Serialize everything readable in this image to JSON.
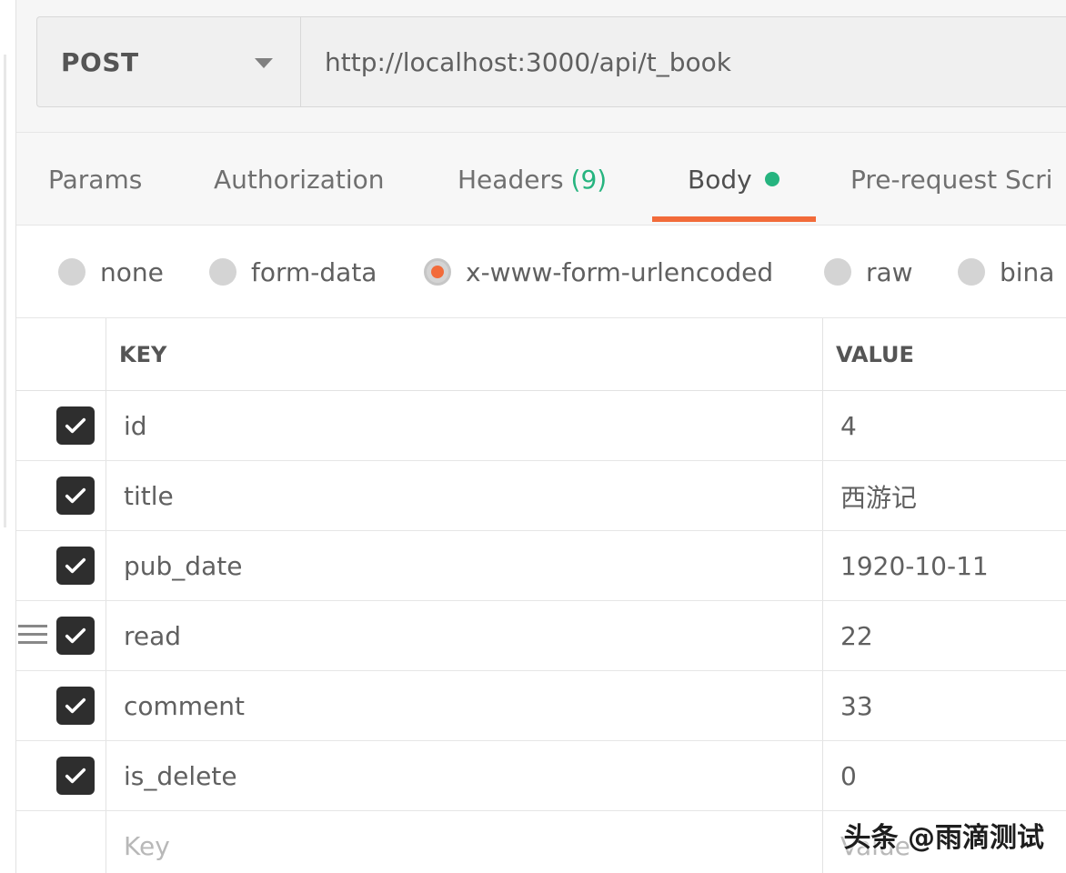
{
  "request": {
    "method": "POST",
    "url": "http://localhost:3000/api/t_book"
  },
  "tabs": [
    {
      "label": "Params"
    },
    {
      "label": "Authorization"
    },
    {
      "label": "Headers",
      "count": "(9)"
    },
    {
      "label": "Body"
    },
    {
      "label": "Pre-request Scri"
    }
  ],
  "body_types": [
    {
      "label": "none",
      "selected": false
    },
    {
      "label": "form-data",
      "selected": false
    },
    {
      "label": "x-www-form-urlencoded",
      "selected": true
    },
    {
      "label": "raw",
      "selected": false
    },
    {
      "label": "bina",
      "selected": false
    }
  ],
  "table": {
    "key_header": "KEY",
    "value_header": "VALUE",
    "rows": [
      {
        "key": "id",
        "value": "4",
        "checked": true
      },
      {
        "key": "title",
        "value": "西游记",
        "checked": true
      },
      {
        "key": "pub_date",
        "value": "1920-10-11",
        "checked": true
      },
      {
        "key": "read",
        "value": "22",
        "checked": true
      },
      {
        "key": "comment",
        "value": "33",
        "checked": true
      },
      {
        "key": "is_delete",
        "value": "0",
        "checked": true
      }
    ],
    "new_row": {
      "key_placeholder": "Key",
      "value_placeholder": "Value"
    }
  },
  "watermark": "头条 @雨滴测试",
  "colors": {
    "accent": "#f26b3a",
    "active_dot": "#26b47f",
    "checkbox": "#2e2e2e"
  },
  "icons": {
    "method_dropdown": "chevron-down-icon",
    "check": "check-icon",
    "drag": "drag-handle-icon"
  }
}
